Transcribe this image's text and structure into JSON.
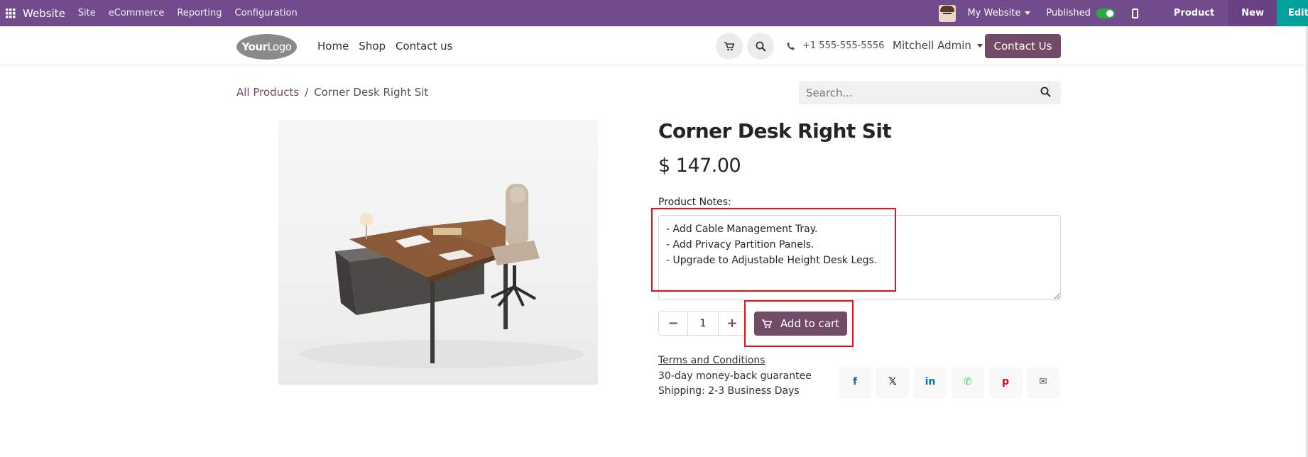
{
  "adminbar": {
    "app_name": "Website",
    "menu": [
      "Site",
      "eCommerce",
      "Reporting",
      "Configuration"
    ],
    "website_selector": "My Website",
    "published_label": "Published",
    "published": true,
    "product_label": "Product",
    "new_label": "New",
    "edit_label": "Edit",
    "bg_color": "#714B8C"
  },
  "header": {
    "logo_text_bold": "Your",
    "logo_text_thin": "Logo",
    "nav": [
      "Home",
      "Shop",
      "Contact us"
    ],
    "phone": "+1 555-555-5556",
    "user": "Mitchell Admin",
    "contact_button": "Contact Us",
    "accent_color": "#714B67"
  },
  "breadcrumb": {
    "parent": "All Products",
    "separator": "/",
    "current": "Corner Desk Right Sit"
  },
  "search": {
    "placeholder": "Search..."
  },
  "product": {
    "title": "Corner Desk Right Sit",
    "price": "$ 147.00",
    "notes_label": "Product Notes:",
    "notes_lines": [
      "- Add Cable Management Tray.",
      "- Add Privacy Partition Panels.",
      "- Upgrade to Adjustable Height Desk Legs."
    ],
    "quantity": "1",
    "minus_symbol": "−",
    "plus_symbol": "+",
    "add_to_cart": "Add to cart",
    "terms": "Terms and Conditions",
    "guarantee": "30-day money-back guarantee",
    "shipping": "Shipping: 2-3 Business Days"
  },
  "share": {
    "icons": [
      "facebook-icon",
      "x-twitter-icon",
      "linkedin-icon",
      "whatsapp-icon",
      "pinterest-icon",
      "envelope-icon"
    ],
    "glyphs": [
      "f",
      "𝕏",
      "in",
      "✆",
      "p",
      "✉"
    ],
    "colors": [
      "#3b5998",
      "#111111",
      "#0077b5",
      "#25d366",
      "#e60023",
      "#714B67"
    ]
  },
  "highlight_color": "#e4111b"
}
